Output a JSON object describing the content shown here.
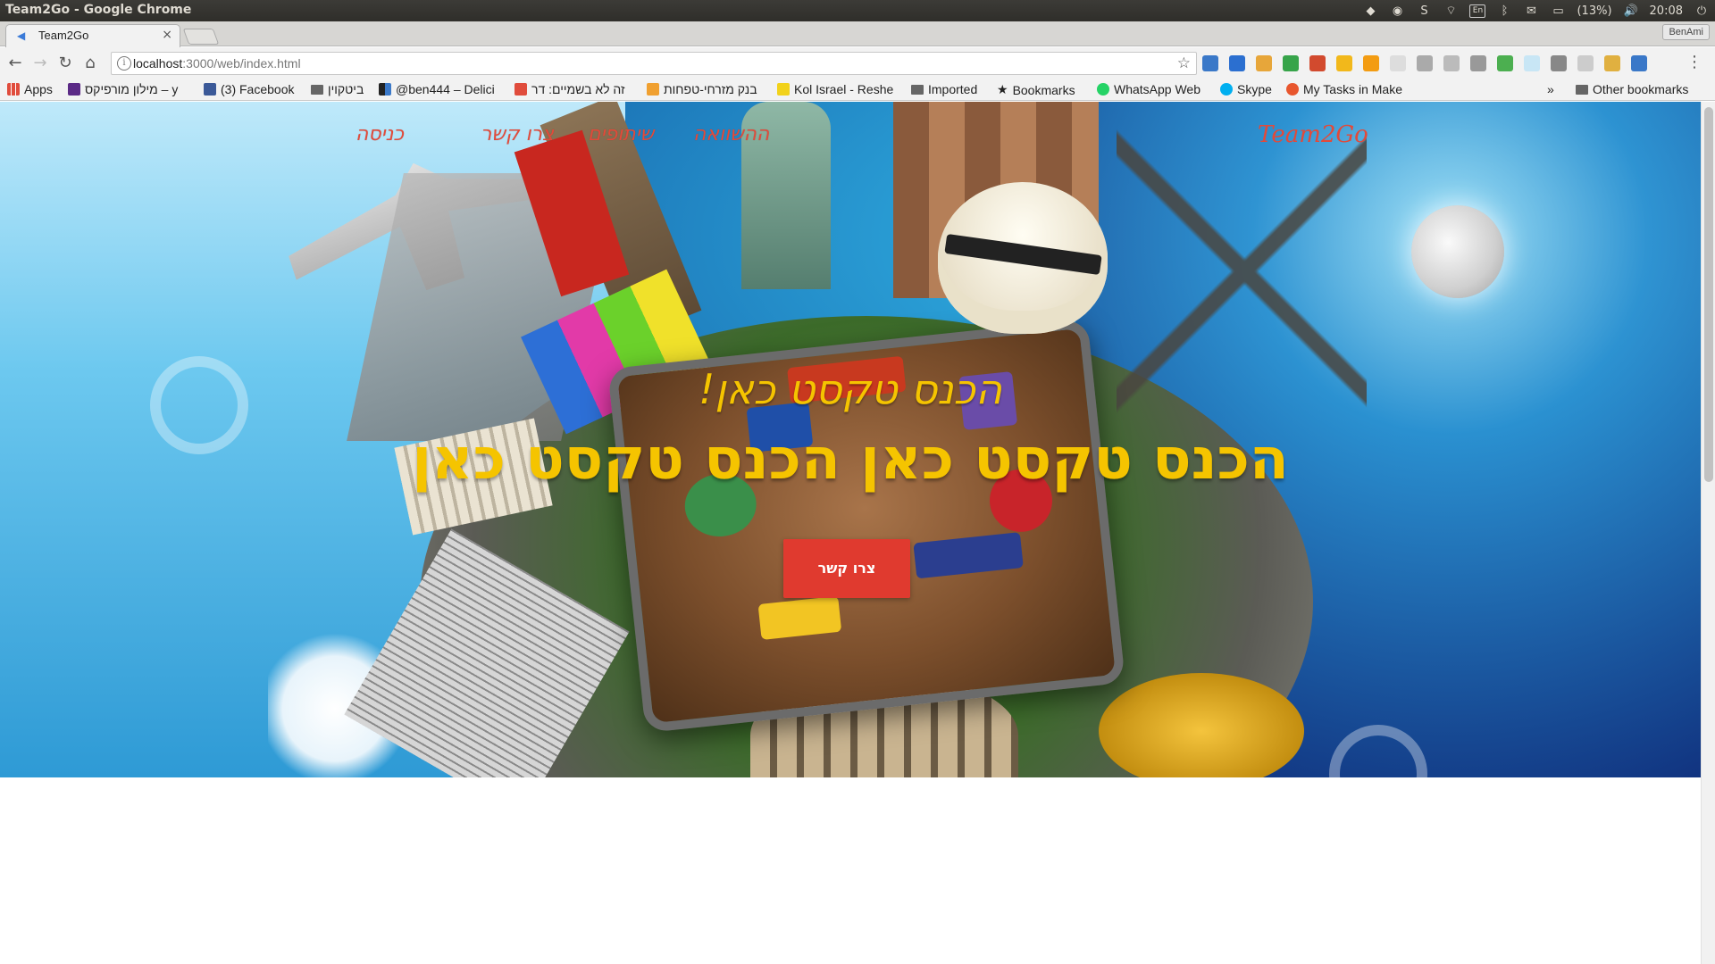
{
  "os": {
    "window_title": "Team2Go - Google Chrome",
    "battery": "(13%)",
    "time": "20:08",
    "keyboard": "En"
  },
  "browser": {
    "tab_title": "Team2Go",
    "tab_close": "×",
    "profile": "BenAmi",
    "url_host": "localhost",
    "url_path": ":3000/web/index.html",
    "bookmarks": [
      "Apps",
      "מילון מורפיקס – y",
      "(3) Facebook",
      "ביטקוין",
      "@ben444 – Delici",
      "זה לא בשמיים: דר",
      "בנק מזרחי-טפחות",
      "Kol Israel - Reshe",
      "Imported",
      "Bookmarks",
      "WhatsApp Web",
      "Skype",
      "My Tasks in Make"
    ],
    "overflow": "»",
    "other_bookmarks": "Other bookmarks"
  },
  "site": {
    "logo": "Team2Go",
    "nav": [
      "כניסה",
      "צרו קשר",
      "שיתופים",
      "ההשוואה"
    ],
    "hero_subtitle": "הכנס טקסט כאן!",
    "hero_title": "הכנס טקסט כאן הכנס טקסט כאן",
    "cta": "צרו קשר"
  },
  "colors": {
    "accent_red": "#e03a2f",
    "hero_yellow": "#f5c400"
  }
}
